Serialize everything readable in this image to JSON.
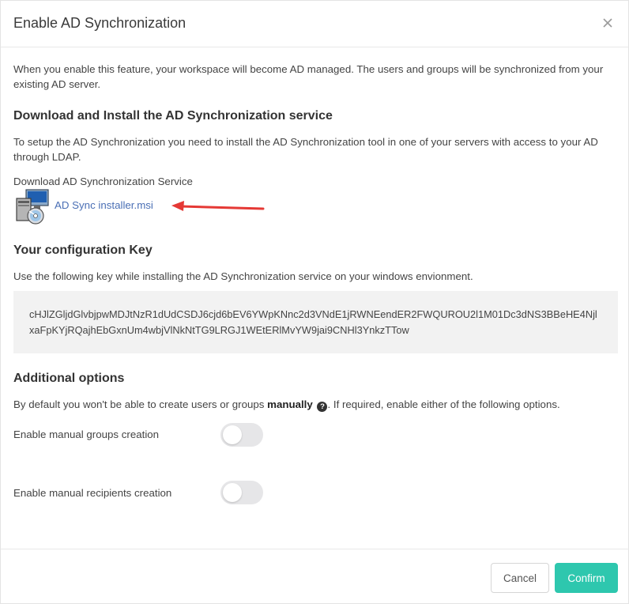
{
  "dialog": {
    "title": "Enable AD Synchronization",
    "intro": "When you enable this feature, your workspace will become AD managed. The users and groups will be synchronized from your existing AD server."
  },
  "download": {
    "heading": "Download and Install the AD Synchronization service",
    "description": "To setup the AD Synchronization you need to install the AD Synchronization tool in one of your servers with access to your AD through LDAP.",
    "label": "Download AD Synchronization Service",
    "file_name": "AD Sync installer.msi",
    "file_icon": "msi-installer-icon"
  },
  "config": {
    "heading": "Your configuration Key",
    "description": "Use the following key while installing the AD Synchronization service on your windows envionment.",
    "key": "cHJlZGljdGlvbjpwMDJtNzR1dUdCSDJ6cjd6bEV6YWpKNnc2d3VNdE1jRWNEendER2FWQUROU2l1M01Dc3dNS3BBeHE4NjlxaFpKYjRQajhEbGxnUm4wbjVlNkNtTG9LRGJ1WEtERlMvYW9jai9CNHl3YnkzTTow"
  },
  "additional": {
    "heading": "Additional options",
    "description_before": "By default you won't be able to create users or groups ",
    "description_bold": "manually",
    "description_after": ". If required, enable either of the following options.",
    "options": [
      {
        "label": "Enable manual groups creation",
        "enabled": false
      },
      {
        "label": "Enable manual recipients creation",
        "enabled": false
      }
    ]
  },
  "footer": {
    "cancel_label": "Cancel",
    "confirm_label": "Confirm"
  },
  "colors": {
    "accent": "#2ec7ae",
    "link": "#4a6fb5",
    "arrow": "#e53935"
  }
}
